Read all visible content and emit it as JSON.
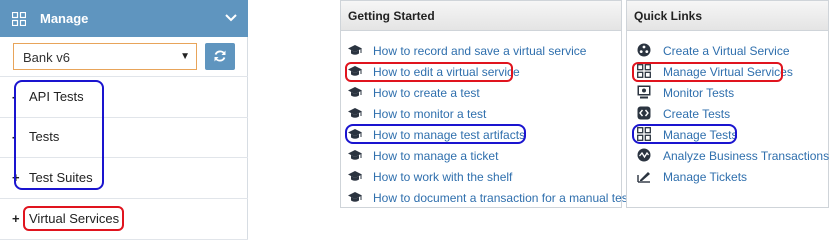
{
  "sidebar": {
    "header_title": "Manage",
    "project_select": {
      "value": "Bank v6"
    },
    "items": [
      {
        "toggle": "-",
        "label": "API Tests"
      },
      {
        "toggle": "-",
        "label": "Tests"
      },
      {
        "toggle": "+",
        "label": "Test Suites"
      },
      {
        "toggle": "+",
        "label": "Virtual Services"
      }
    ]
  },
  "getting_started": {
    "title": "Getting Started",
    "links": [
      {
        "label": "How to record and save a virtual service",
        "icon": "graduation-cap-icon"
      },
      {
        "label": "How to edit a virtual service",
        "icon": "graduation-cap-icon"
      },
      {
        "label": "How to create a test",
        "icon": "graduation-cap-icon"
      },
      {
        "label": "How to monitor a test",
        "icon": "graduation-cap-icon"
      },
      {
        "label": "How to manage test artifacts",
        "icon": "graduation-cap-icon"
      },
      {
        "label": "How to manage a ticket",
        "icon": "graduation-cap-icon"
      },
      {
        "label": "How to work with the shelf",
        "icon": "graduation-cap-icon"
      },
      {
        "label": "How to document a transaction for a manual test",
        "icon": "graduation-cap-icon"
      }
    ]
  },
  "quick_links": {
    "title": "Quick Links",
    "links": [
      {
        "label": "Create a Virtual Service",
        "icon": "virtual-service-icon"
      },
      {
        "label": "Manage Virtual Services",
        "icon": "grid-icon"
      },
      {
        "label": "Monitor Tests",
        "icon": "monitor-icon"
      },
      {
        "label": "Create Tests",
        "icon": "code-icon"
      },
      {
        "label": "Manage Tests",
        "icon": "grid-icon"
      },
      {
        "label": "Analyze Business Transactions",
        "icon": "pulse-icon"
      },
      {
        "label": "Manage Tickets",
        "icon": "ticket-icon"
      }
    ]
  },
  "colors": {
    "accent": "#5f95bf",
    "link": "#2f6fad",
    "highlight_red": "#e0141e",
    "highlight_blue": "#1a14cf"
  }
}
